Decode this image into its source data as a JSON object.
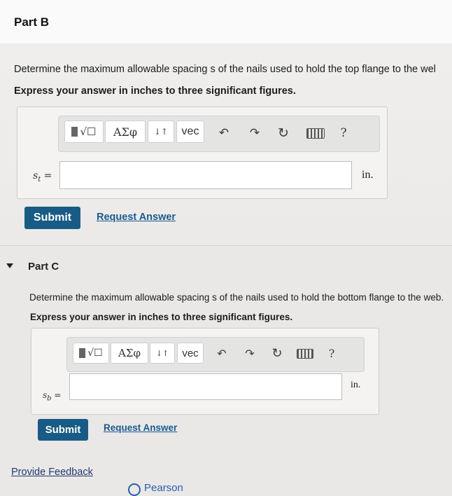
{
  "partB": {
    "title": "Part B",
    "question": "Determine the maximum allowable spacing s of the nails used to hold the top flange to the wel",
    "instruction": "Express your answer in inches to three significant figures.",
    "variable": "s",
    "variable_sub": "t",
    "equals": "=",
    "unit": "in.",
    "input_value": "",
    "submit_label": "Submit",
    "request_label": "Request Answer"
  },
  "partC": {
    "title": "Part C",
    "question": "Determine the maximum allowable spacing s of the nails used to hold the bottom flange to the web.",
    "instruction": "Express your answer in inches to three significant figures.",
    "variable": "s",
    "variable_sub": "b",
    "equals": "=",
    "unit": "in.",
    "input_value": "",
    "submit_label": "Submit",
    "request_label": "Request Answer"
  },
  "toolbar": {
    "greek_label": "ΑΣφ",
    "arrows_label": "↓↑",
    "vec_label": "vec",
    "help_label": "?",
    "templates_icon": "template-icon",
    "undo_icon": "undo-icon",
    "redo_icon": "redo-icon",
    "reset_icon": "reset-icon",
    "keyboard_icon": "keyboard-icon"
  },
  "footer": {
    "feedback_label": "Provide Feedback",
    "brand": "Pearson"
  }
}
